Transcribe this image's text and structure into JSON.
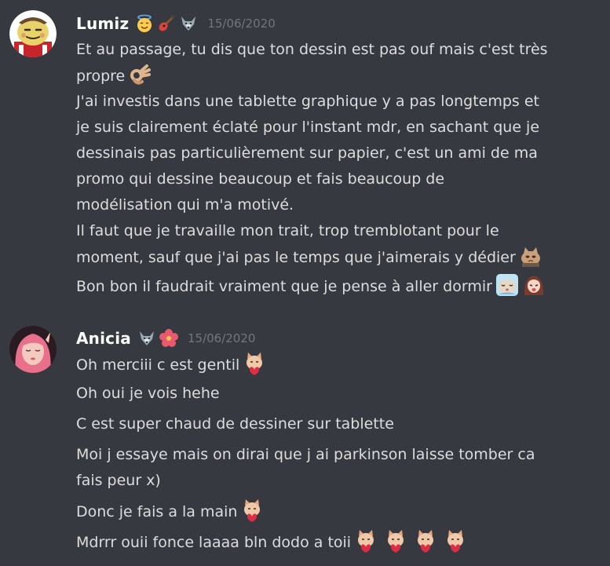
{
  "messages": [
    {
      "author": "Lumiz",
      "timestamp": "15/06/2020",
      "badges": [
        "angel-face-icon",
        "guitar-icon",
        "wolf-icon"
      ],
      "lines": [
        "Et au passage, tu dis que ton dessin est pas ouf mais c'est très",
        "propre",
        "J'ai investis dans une tablette graphique y a pas longtemps et",
        "je suis clairement éclaté pour l'instant mdr, en sachant que je",
        "dessinais pas particulièrement sur papier, c'est un ami de ma",
        "promo qui dessine beaucoup et fais beaucoup de",
        "modélisation qui m'a motivé.",
        "Il faut que je travaille mon trait, trop tremblotant pour le",
        "moment, sauf que j'ai pas le temps que j'aimerais y dédier",
        "Bon bon il faudrait vraiment que je pense à aller dormir"
      ],
      "line_emojis": {
        "1": [
          "ok-hand-icon"
        ],
        "8": [
          "cat-meme-icon"
        ],
        "9": [
          "sleepy-pepe-icon",
          "anime-girl-icon"
        ]
      },
      "avatar_icon": "cartoon-character-icon"
    },
    {
      "author": "Anicia",
      "timestamp": "15/06/2020",
      "badges": [
        "wolf-icon",
        "hibiscus-icon"
      ],
      "lines": [
        "Oh merciii c est gentil",
        "Oh oui je vois hehe",
        "C est super chaud de dessiner sur tablette",
        "Moi j essaye mais on dirai que j ai parkinson laisse tomber ca",
        "fais peur x)",
        "Donc je fais a la main",
        "Mdrrr ouii fonce laaaa bln dodo a toii"
      ],
      "line_emojis": {
        "0": [
          "cat-heart-icon"
        ],
        "5": [
          "cat-heart-icon"
        ],
        "6": [
          "cat-heart-icon",
          "cat-heart-icon",
          "cat-heart-icon",
          "cat-heart-icon"
        ]
      },
      "avatar_icon": "pink-hair-girl-icon"
    }
  ],
  "colors": {
    "background": "#36393f",
    "username": "#ffffff",
    "text": "#dcddde",
    "timestamp": "#72767d"
  }
}
